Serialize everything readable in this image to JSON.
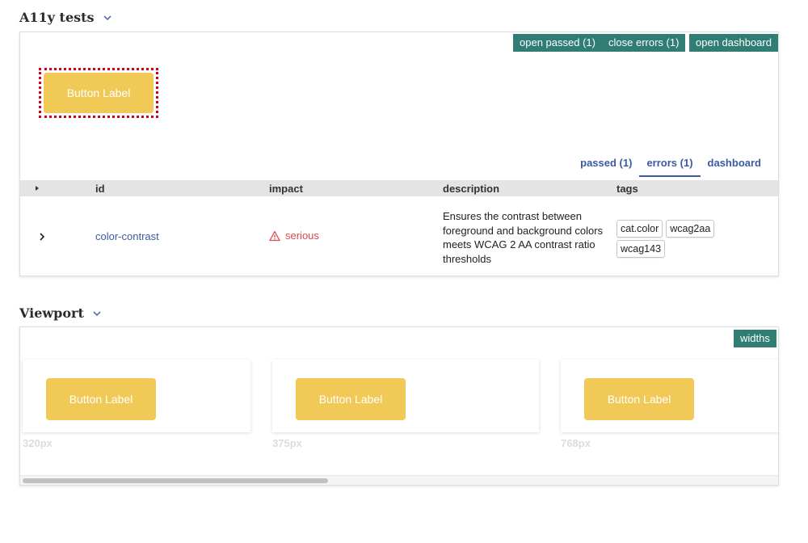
{
  "a11y": {
    "title": "A11y tests",
    "buttons": {
      "open_passed": "open passed (1)",
      "close_errors": "close errors (1)",
      "open_dashboard": "open dashboard"
    },
    "preview_button_label": "Button Label",
    "tabs": [
      "passed (1)",
      "errors (1)",
      "dashboard"
    ],
    "active_tab": "errors (1)",
    "table": {
      "headers": [
        "id",
        "impact",
        "description",
        "tags"
      ],
      "row": {
        "id": "color-contrast",
        "impact": "serious",
        "description": "Ensures the contrast between foreground and background colors meets WCAG 2 AA contrast ratio thresholds",
        "tags": [
          "cat.color",
          "wcag2aa",
          "wcag143"
        ]
      }
    }
  },
  "viewport": {
    "title": "Viewport",
    "widths_button": "widths",
    "frames": [
      {
        "label": "320px",
        "button_label": "Button Label"
      },
      {
        "label": "375px",
        "button_label": "Button Label"
      },
      {
        "label": "768px",
        "button_label": "Button Label"
      }
    ]
  },
  "colors": {
    "accent": "#2f7d73",
    "button_yellow": "#f0c956",
    "link_blue": "#3c5aa0",
    "serious_red": "#e0464a"
  }
}
